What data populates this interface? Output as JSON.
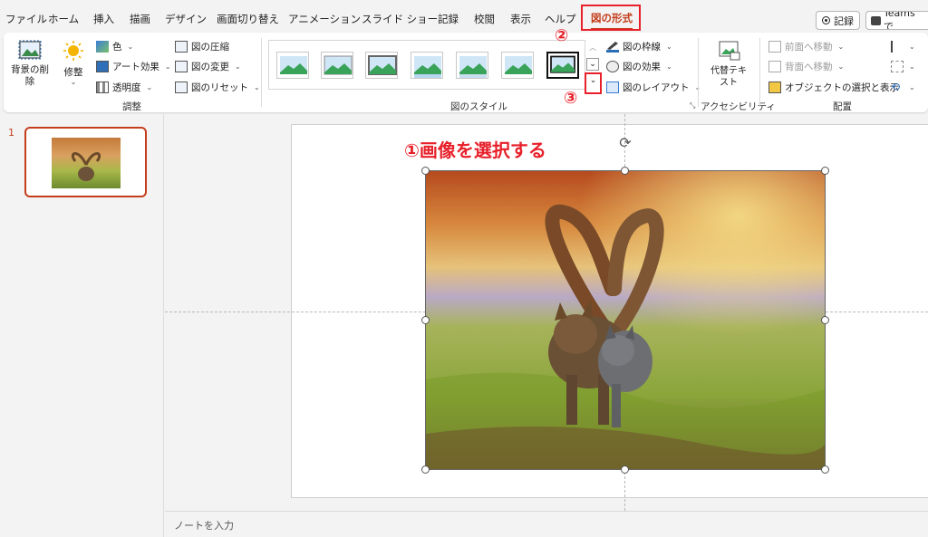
{
  "tabs": {
    "file": "ファイル",
    "home": "ホーム",
    "insert": "挿入",
    "draw": "描画",
    "design": "デザイン",
    "transitions": "画面切り替え",
    "animations": "アニメーション",
    "slideshow": "スライド ショー",
    "record": "記録",
    "review": "校閲",
    "view": "表示",
    "help": "ヘルプ",
    "picture_format": "図の形式"
  },
  "top_right": {
    "record_button": "記録",
    "teams_button": "Teams で"
  },
  "ribbon": {
    "remove_background": "背景の削除",
    "corrections": "修整",
    "color": "色",
    "artistic_effects": "アート効果",
    "transparency": "透明度",
    "compress": "図の圧縮",
    "change_picture": "図の変更",
    "reset_picture": "図のリセット",
    "adjust_group": "調整",
    "styles_group": "図のスタイル",
    "picture_border": "図の枠線",
    "picture_effects": "図の効果",
    "picture_layout": "図のレイアウト",
    "alt_text": "代替テキスト",
    "accessibility_group": "アクセシビリティ",
    "bring_forward": "前面へ移動",
    "send_backward": "背面へ移動",
    "selection_pane": "オブジェクトの選択と表示",
    "arrange_group": "配置"
  },
  "annotations": {
    "step1": "①画像を選択する",
    "step2": "②",
    "step3": "③"
  },
  "slide_panel": {
    "slide_number": "1"
  },
  "notes": {
    "placeholder": "ノートを入力"
  },
  "colors": {
    "accent": "#c43e1c",
    "annotation_red": "#e8202a"
  }
}
